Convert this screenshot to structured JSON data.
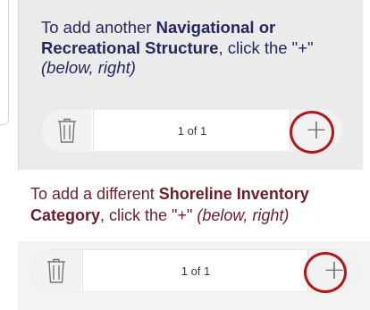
{
  "inner_section": {
    "instruction_part1": "To add another ",
    "instruction_bold": "Navigational or Recreational Structure",
    "instruction_part2": ", click the \"+\" ",
    "instruction_italic": "(below, right)",
    "pager": {
      "delete_icon": "trash-icon",
      "count_label": "1 of 1",
      "add_label": "+"
    }
  },
  "outer_section": {
    "instruction_part1": "To add a different ",
    "instruction_bold": "Shoreline Inventory Category",
    "instruction_part2": ", click the \"+\" ",
    "instruction_italic": "(below, right)",
    "pager": {
      "delete_icon": "trash-icon",
      "count_label": "1 of 1",
      "add_label": "+"
    }
  },
  "colors": {
    "inner_text": "#23285d",
    "outer_text": "#6b1f2a",
    "highlight_ring": "#b3161c"
  }
}
